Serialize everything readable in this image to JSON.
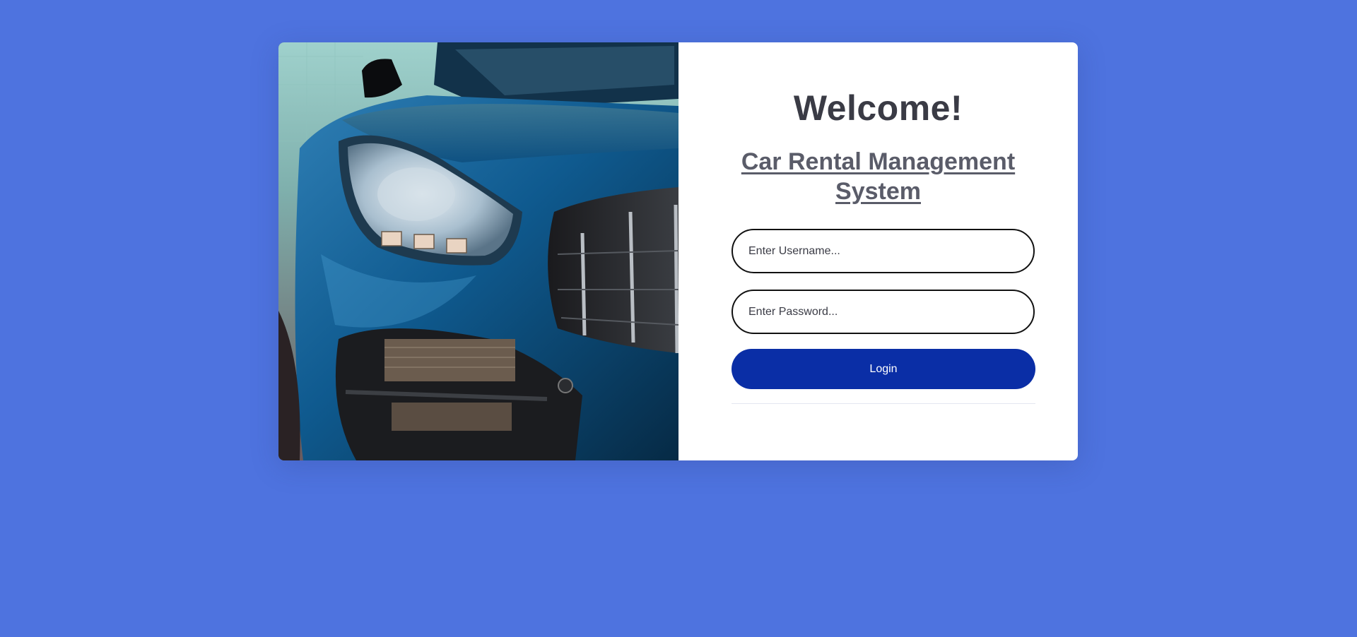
{
  "login_card": {
    "welcome_title": "Welcome!",
    "subtitle": "Car Rental Management System",
    "username": {
      "placeholder": "Enter Username...",
      "value": ""
    },
    "password": {
      "placeholder": "Enter Password...",
      "value": ""
    },
    "login_label": "Login"
  },
  "colors": {
    "page_background": "#4e73df",
    "card_background": "#ffffff",
    "title_text": "#3a3b45",
    "subtitle_text": "#5a5c69",
    "login_button": "#0a2ea6",
    "car_body": "#0f4d7a"
  }
}
